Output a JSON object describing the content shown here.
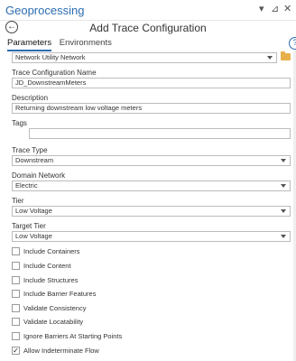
{
  "pane": {
    "title": "Geoprocessing",
    "pin_glyph": "⊿",
    "menu_glyph": "▾",
    "close_glyph": "✕"
  },
  "tool": {
    "title": "Add Trace Configuration",
    "back_glyph": "←",
    "help_glyph": "?"
  },
  "tabs": [
    {
      "label": "Parameters",
      "active": true
    },
    {
      "label": "Environments",
      "active": false
    }
  ],
  "fields": {
    "input_network": {
      "value": "Network Utility Network"
    },
    "trace_config_name": {
      "label": "Trace Configuration Name",
      "value": "JD_DownstreamMeters"
    },
    "description": {
      "label": "Description",
      "value": "Returning downstream low voltage meters"
    },
    "tags": {
      "label": "Tags",
      "value": ""
    },
    "trace_type": {
      "label": "Trace Type",
      "value": "Downstream"
    },
    "domain_network": {
      "label": "Domain Network",
      "value": "Electric"
    },
    "tier": {
      "label": "Tier",
      "value": "Low Voltage"
    },
    "target_tier": {
      "label": "Target Tier",
      "value": "Low Voltage"
    }
  },
  "checkboxes": [
    {
      "label": "Include Containers",
      "checked": false
    },
    {
      "label": "Include Content",
      "checked": false
    },
    {
      "label": "Include Structures",
      "checked": false
    },
    {
      "label": "Include Barrier Features",
      "checked": false
    },
    {
      "label": "Validate Consistency",
      "checked": false
    },
    {
      "label": "Validate Locatability",
      "checked": false
    },
    {
      "label": "Ignore Barriers At Starting Points",
      "checked": false
    },
    {
      "label": "Allow Indeterminate Flow",
      "checked": true
    }
  ],
  "check_glyph": "✓",
  "colors": {
    "accent": "#2b6cb0",
    "folder": "#e8b04a"
  }
}
